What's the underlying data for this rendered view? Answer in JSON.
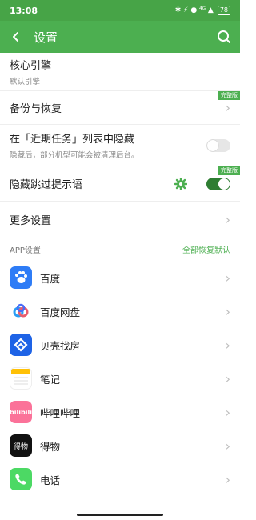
{
  "status_bar": {
    "time": "13:08",
    "icons_text": "✱ ⚡ ● ⁴ᴳ ▲",
    "battery": "78"
  },
  "app_bar": {
    "title": "设置"
  },
  "settings": [
    {
      "label": "核心引擎",
      "sub": "默认引擎"
    },
    {
      "label": "备份与恢复",
      "badge": "完整版"
    },
    {
      "label": "在「近期任务」列表中隐藏",
      "sub": "隐藏后，部分机型可能会被清理后台。",
      "toggle": "off"
    },
    {
      "label": "隐藏跳过提示语",
      "badge": "完整版",
      "toggle": "on"
    },
    {
      "label": "更多设置"
    }
  ],
  "section": {
    "title": "APP设置",
    "action": "全部恢复默认"
  },
  "apps": [
    {
      "label": "百度",
      "color": "#2e7cf6"
    },
    {
      "label": "百度网盘",
      "color": "#ffffff"
    },
    {
      "label": "贝壳找房",
      "color": "#1e63e6"
    },
    {
      "label": "笔记",
      "color": "#ffffff"
    },
    {
      "label": "哔哩哔哩",
      "color": "#fb7299"
    },
    {
      "label": "得物",
      "color": "#111111"
    },
    {
      "label": "电话",
      "color": "#4cd964"
    }
  ],
  "icons": {
    "baidu": "bilibili-text",
    "bilibili_text": "bilibili",
    "dewu_text": "得物"
  }
}
